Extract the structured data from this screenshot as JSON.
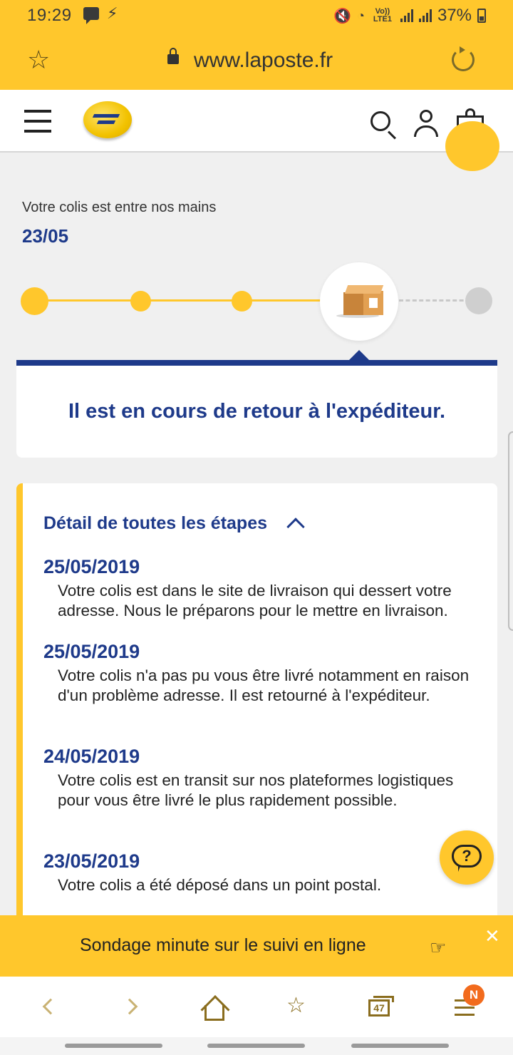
{
  "status_bar": {
    "time": "19:29",
    "network_label": "Vo)) LTE1",
    "battery": "37%"
  },
  "browser": {
    "url": "www.laposte.fr",
    "tabs_count": "47",
    "notification_badge": "N"
  },
  "tracking": {
    "status_label": "Votre colis est entre nos mains",
    "status_date": "23/05",
    "current_step": 4,
    "total_steps": 5,
    "message": "Il est en cours de retour à l'expéditeur."
  },
  "details": {
    "heading": "Détail de toutes les étapes",
    "events": [
      {
        "date": "25/05/2019",
        "text": "Votre colis est dans le site de livraison qui dessert votre adresse. Nous le préparons pour le mettre en livraison."
      },
      {
        "date": "25/05/2019",
        "text": "Votre colis n'a pas pu vous être livré notamment en raison d'un problème adresse. Il est retourné à l'expéditeur."
      },
      {
        "date": "24/05/2019",
        "text": "Votre colis est en transit sur nos plateformes logistiques pour vous être livré le plus rapidement possible."
      },
      {
        "date": "23/05/2019",
        "text": "Votre colis a été déposé dans un point postal."
      }
    ]
  },
  "help": {
    "symbol": "?"
  },
  "survey": {
    "text": "Sondage minute sur le suivi en ligne",
    "close": "✕"
  },
  "colors": {
    "brand_yellow": "#ffc72c",
    "brand_blue": "#1e3a8a"
  }
}
